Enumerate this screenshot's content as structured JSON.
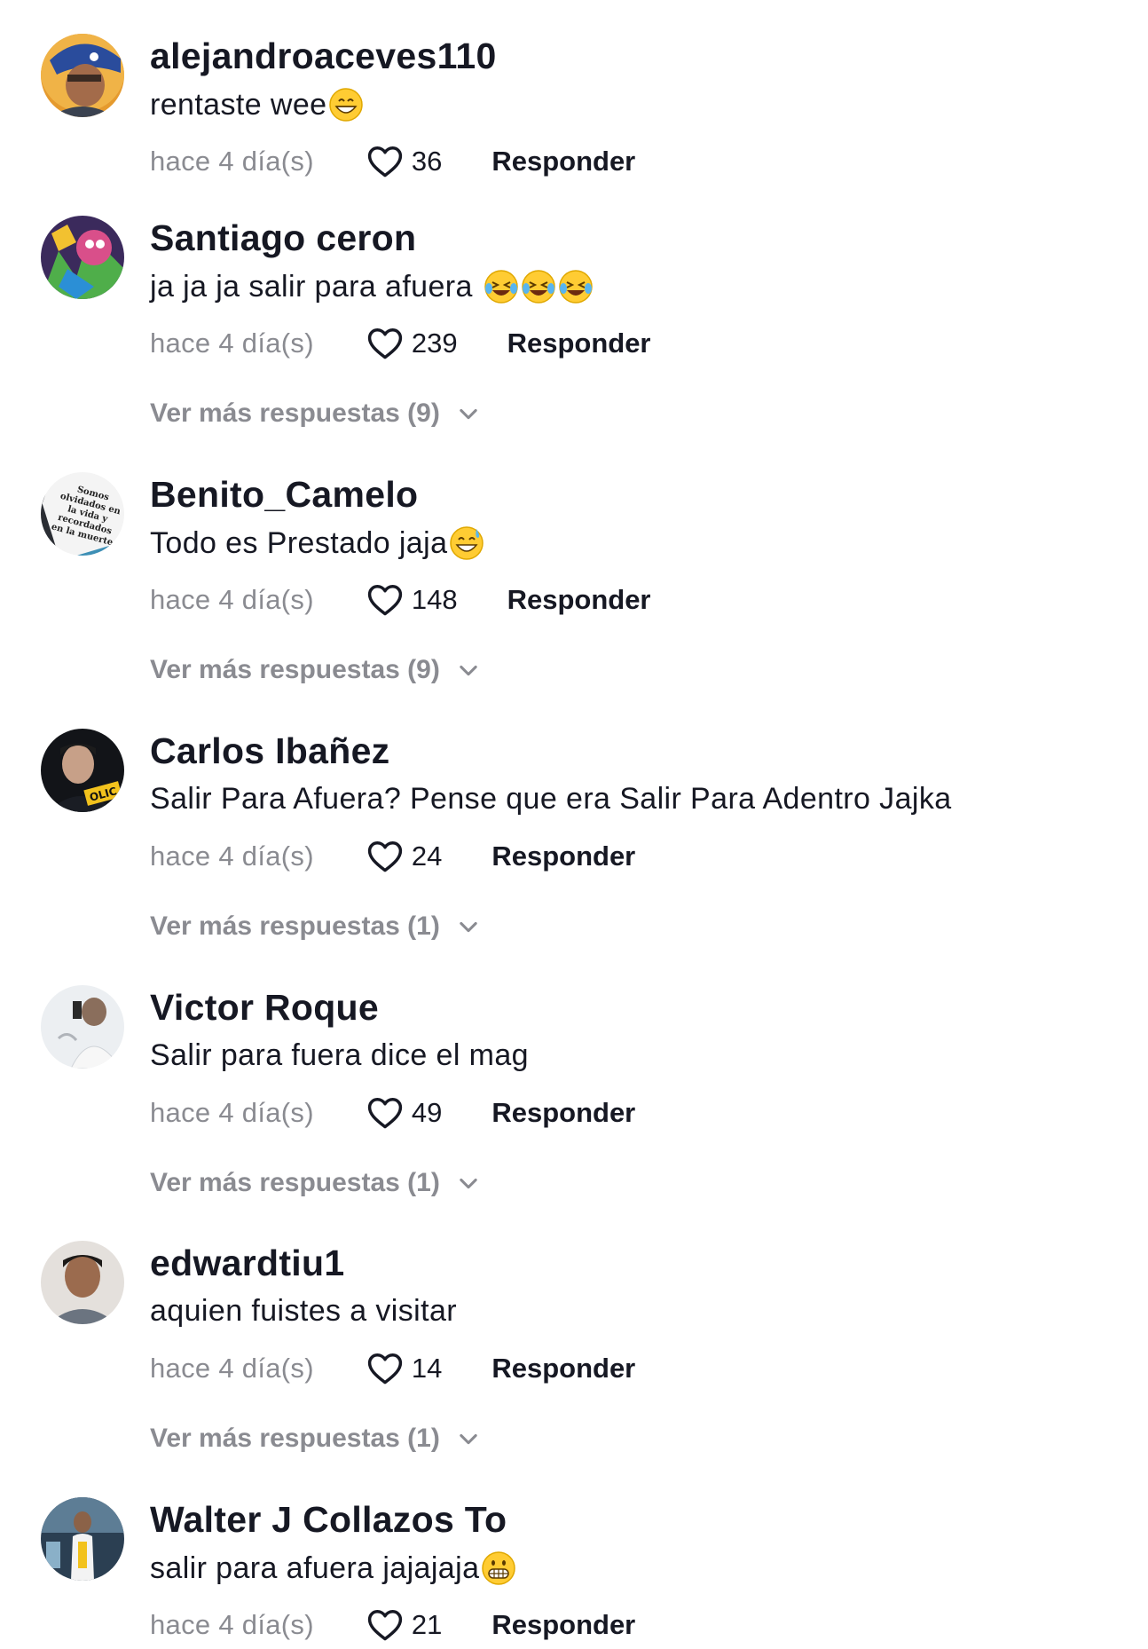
{
  "comments": [
    {
      "username": "alejandroaceves110",
      "text": "rentaste wee",
      "emojis": [
        "grin"
      ],
      "time": "hace 4 día(s)",
      "likes": "36",
      "reply_label": "Responder",
      "more_replies": ""
    },
    {
      "username": "Santiago ceron",
      "text": "ja ja ja salir para afuera ",
      "emojis": [
        "joy",
        "joy",
        "joy"
      ],
      "time": "hace 4 día(s)",
      "likes": "239",
      "reply_label": "Responder",
      "more_replies": "Ver más respuestas (9)"
    },
    {
      "username": "Benito_Camelo",
      "text": "Todo es Prestado jaja",
      "emojis": [
        "sweat-smile"
      ],
      "time": "hace 4 día(s)",
      "likes": "148",
      "reply_label": "Responder",
      "more_replies": "Ver más respuestas (9)"
    },
    {
      "username": "Carlos Ibañez",
      "text": "Salir Para Afuera? Pense que era Salir Para Adentro Jajka",
      "emojis": [],
      "time": "hace 4 día(s)",
      "likes": "24",
      "reply_label": "Responder",
      "more_replies": "Ver más respuestas (1)"
    },
    {
      "username": "Victor Roque",
      "text": "Salir para fuera dice el mag",
      "emojis": [],
      "time": "hace 4 día(s)",
      "likes": "49",
      "reply_label": "Responder",
      "more_replies": "Ver más respuestas (1)"
    },
    {
      "username": "edwardtiu1",
      "text": "aquien fuistes a visitar",
      "emojis": [],
      "time": "hace 4 día(s)",
      "likes": "14",
      "reply_label": "Responder",
      "more_replies": "Ver más respuestas (1)"
    },
    {
      "username": "Walter J Collazos To",
      "text": "salir para afuera jajajaja",
      "emojis": [
        "grimace"
      ],
      "time": "hace 4 día(s)",
      "likes": "21",
      "reply_label": "Responder",
      "more_replies": ""
    }
  ],
  "avatar3_text": "Somos olvidados en la vida y recordados en la muerte",
  "avatar4_text": "OLIC",
  "colors": {
    "text_primary": "#161823",
    "text_secondary": "#8a8b91",
    "background": "#ffffff"
  },
  "icons": {
    "like": "heart-outline-icon",
    "more": "chevron-down-icon"
  }
}
